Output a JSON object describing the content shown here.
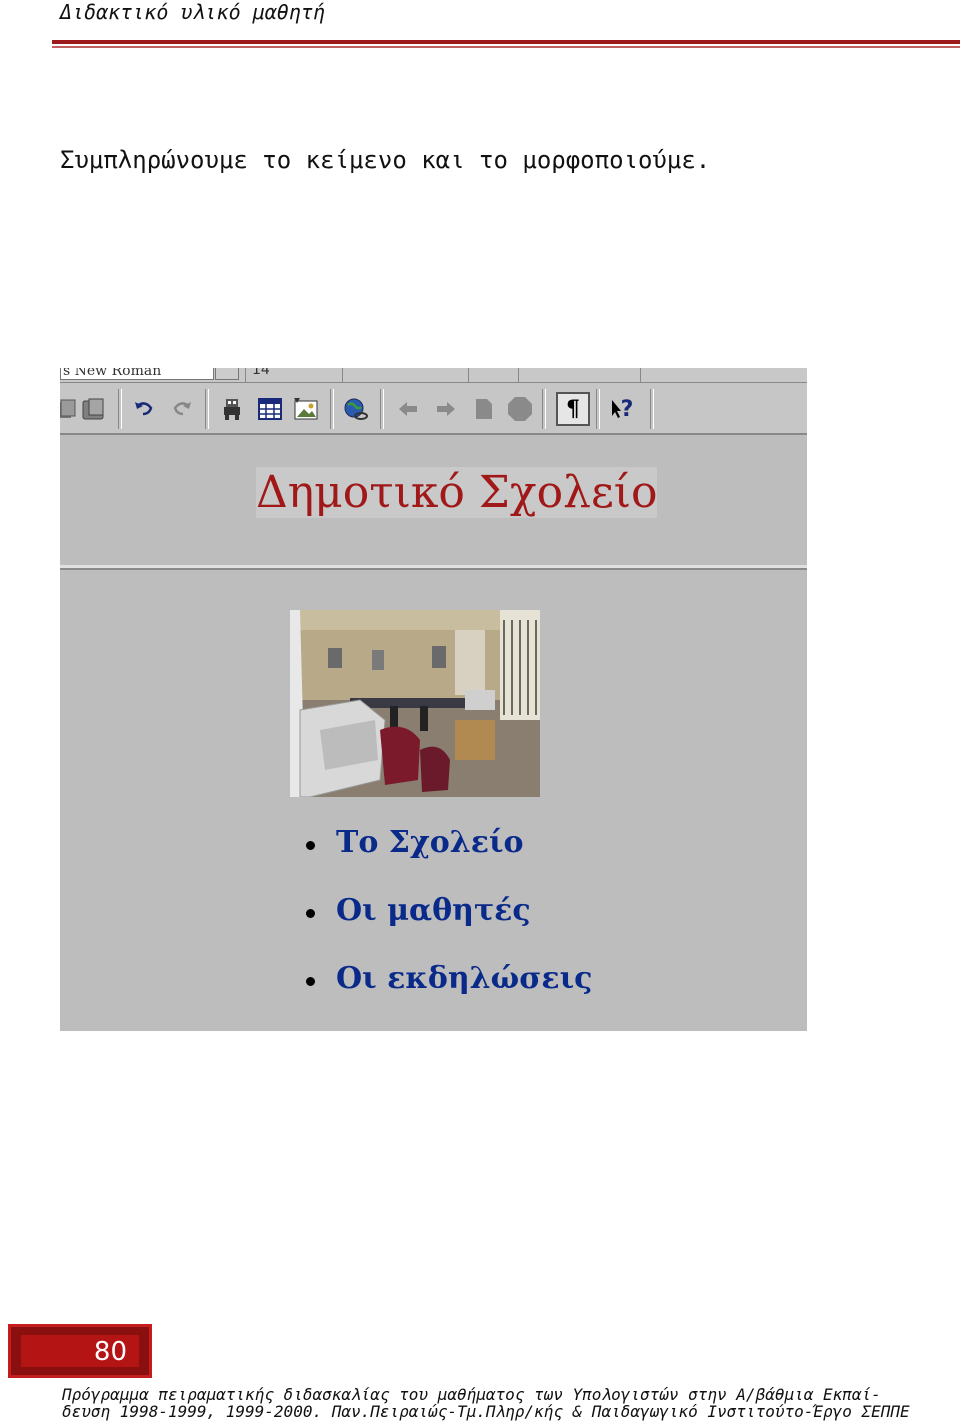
{
  "header": {
    "title": "Διδακτικό υλικό μαθητή"
  },
  "instruction": "Συμπληρώνουμε το κείμενο και το μορφοποιούμε.",
  "screenshot": {
    "toolbar": {
      "font_name": "s New Roman",
      "font_size": "14",
      "icons": [
        "copy-icon",
        "paste-icon",
        "undo-icon",
        "redo-icon",
        "webbot-icon",
        "table-icon",
        "image-icon",
        "hyperlink-icon",
        "back-icon",
        "forward-icon",
        "refresh-icon",
        "stop-icon",
        "show-formatting-icon",
        "help-icon"
      ],
      "pilcrow": "¶",
      "help": "?"
    },
    "banner_title": "Δημοτικό Σχολείο",
    "links": [
      "Το Σχολείο",
      "Οι μαθητές",
      "Οι εκδηλώσεις"
    ]
  },
  "footer": {
    "page_number": "80",
    "line1": "Πρόγραμμα πειραματικής διδασκαλίας του μαθήματος των Υπολογιστών στην  Α/βάθμια Εκπαί-",
    "line2": "δευση 1998-1999, 1999-2000. Παν.Πειραιώς-Τμ.Πληρ/κής & Παιδαγωγικό Ινστιτούτο-Έργο ΣΕΠΠΕ"
  }
}
